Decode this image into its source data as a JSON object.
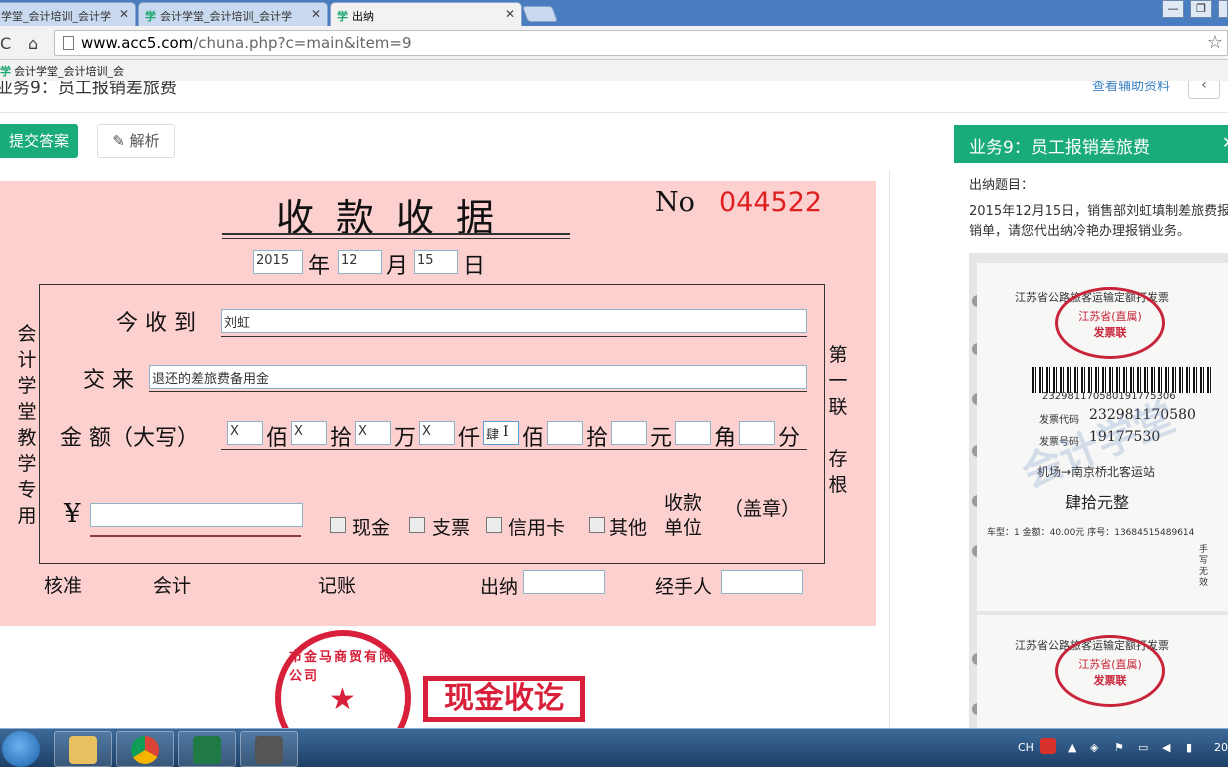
{
  "browser": {
    "tabs": [
      {
        "label": "学堂_会计培训_会计学",
        "active": false
      },
      {
        "logo": "学",
        "label": "会计学堂_会计培训_会计学",
        "active": false
      },
      {
        "logo": "学",
        "label": "出纳",
        "active": true
      }
    ],
    "url_host": "www.acc5.com",
    "url_path": "/chuna.php?c=main&item=9",
    "bookmark_logo": "学",
    "bookmark": "会计学堂_会计培训_会"
  },
  "page": {
    "title": "业务9：员工报销差旅费",
    "help_link": "查看辅助资料",
    "back_icon": "chevron-left-icon",
    "submit_label": "提交答案",
    "analysis_label": "解析",
    "analysis_icon": "wrench-icon"
  },
  "receipt": {
    "title": "收款收据",
    "no_label": "No",
    "number": "044522",
    "year": "2015",
    "year_label": "年",
    "month": "12",
    "month_label": "月",
    "day": "15",
    "day_label": "日",
    "side_left": [
      "会",
      "计",
      "学",
      "堂",
      "教",
      "学",
      "专",
      "用"
    ],
    "side_right": [
      "第",
      "一",
      "联",
      "",
      "存",
      "根"
    ],
    "received_from_label": "今 收 到",
    "received_from": "刘虹",
    "reason_label": "交 来",
    "reason": "退还的差旅费备用金",
    "amount_label": "金 额（大写）",
    "amount_units": [
      {
        "value": "X",
        "unit": "佰"
      },
      {
        "value": "X",
        "unit": "拾"
      },
      {
        "value": "X",
        "unit": "万"
      },
      {
        "value": "X",
        "unit": "仟"
      },
      {
        "value": "肆",
        "unit": "佰"
      },
      {
        "value": "",
        "unit": "拾"
      },
      {
        "value": "",
        "unit": "元"
      },
      {
        "value": "",
        "unit": "角"
      },
      {
        "value": "",
        "unit": "分"
      }
    ],
    "yen_symbol": "¥",
    "yen_value": "",
    "payment_options": [
      "现金",
      "支票",
      "信用卡",
      "其他"
    ],
    "payee_unit_line1": "收款",
    "payee_unit_line2": "单位",
    "seal_label": "（盖章）",
    "approve_label": "核准",
    "accountant_label": "会计",
    "bookkeeper_label": "记账",
    "cashier_label": "出纳",
    "cashier_value": "",
    "handler_label": "经手人",
    "handler_value": ""
  },
  "stamps": {
    "round_text": "市金马商贸有限公司",
    "rect_text": "现金收讫"
  },
  "right_panel": {
    "title": "业务9：员工报销差旅费",
    "label": "出纳题目：",
    "description": "2015年12月15日，销售部刘虹填制差旅费报销单，请您代出纳冷艳办理报销业务。",
    "ticket": {
      "header": "江苏省公路旅客运输定额打发票",
      "oval_text": "发票联",
      "oval_sub": "江苏省(直属)",
      "barcode_num": "232981170580191775306",
      "code_label": "发票代码",
      "code": "232981170580",
      "number_label": "发票号码",
      "number": "19177530",
      "route": "机场→南京桥北客运站",
      "amount_words": "肆拾元整",
      "detail": "车型：1 金额：40.00元 序号：13684515489614",
      "side_note": "手写无效",
      "watermark": "会计学堂"
    }
  },
  "taskbar": {
    "lang": "CH",
    "clock": "20"
  }
}
